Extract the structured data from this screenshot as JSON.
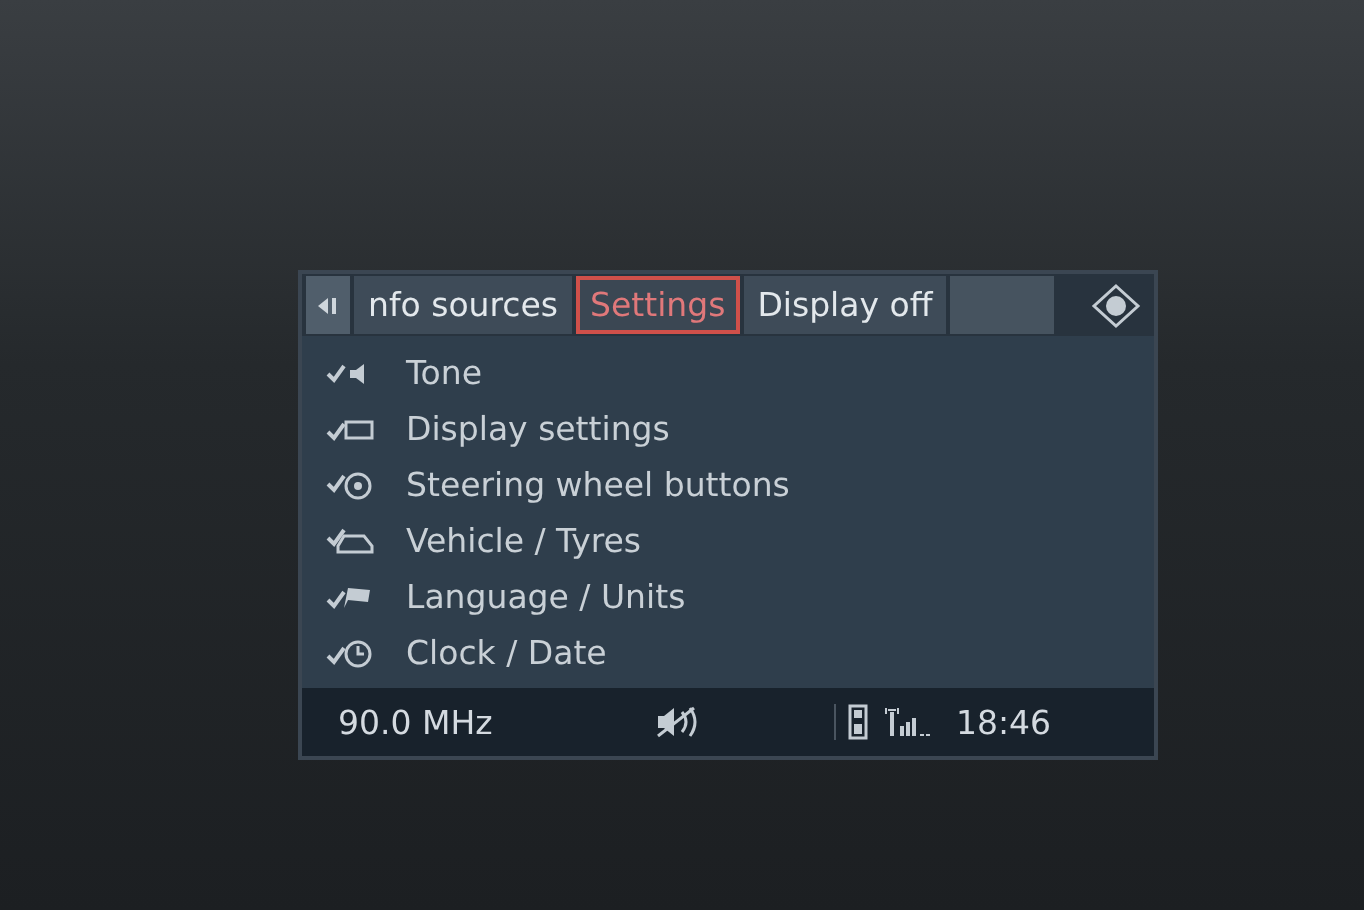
{
  "tabs": [
    {
      "label": "nfo sources",
      "selected": false
    },
    {
      "label": "Settings",
      "selected": true
    },
    {
      "label": "Display off",
      "selected": false
    }
  ],
  "menu": {
    "items": [
      {
        "label": "Tone"
      },
      {
        "label": "Display settings"
      },
      {
        "label": "Steering wheel buttons"
      },
      {
        "label": "Vehicle / Tyres"
      },
      {
        "label": "Language / Units"
      },
      {
        "label": "Clock / Date"
      }
    ]
  },
  "status_bar": {
    "frequency": "90.0 MHz",
    "time": "18:46"
  }
}
